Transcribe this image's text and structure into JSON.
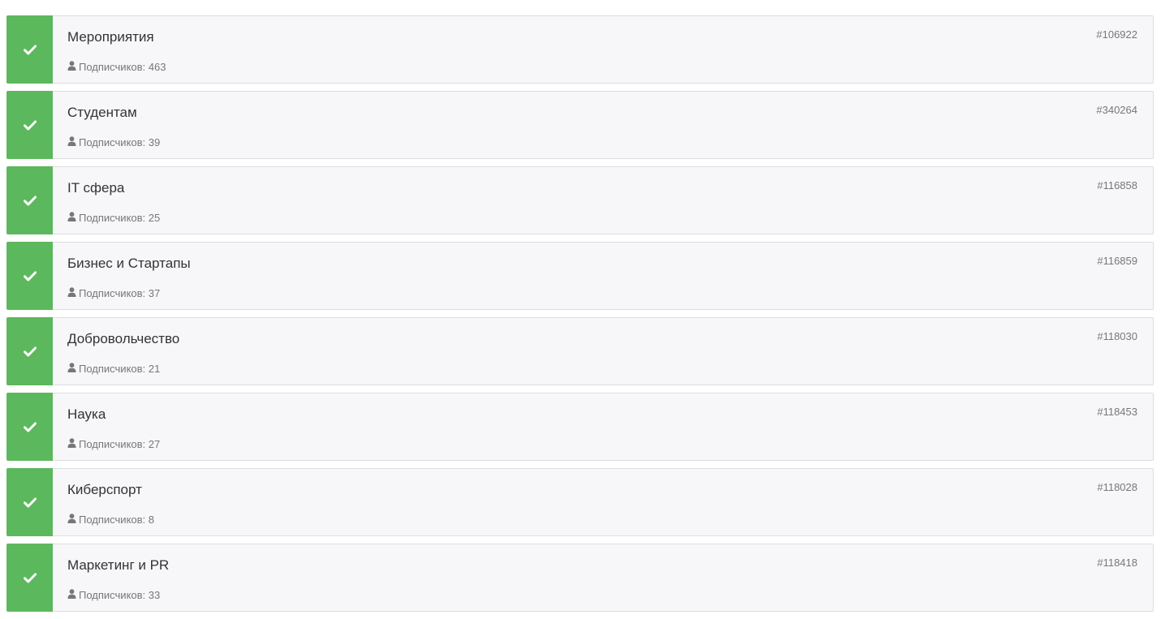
{
  "subscriber_prefix": "Подписчиков:",
  "colors": {
    "check_bg": "#5cb85c",
    "row_bg": "#f7f7f9",
    "row_border": "#dcdde2"
  },
  "icons": {
    "check": "check-icon",
    "user": "user-icon"
  },
  "items": [
    {
      "title": "Мероприятия",
      "subscribers": "Подписчиков: 463",
      "id": "#106922"
    },
    {
      "title": "Студентам",
      "subscribers": "Подписчиков: 39",
      "id": "#340264"
    },
    {
      "title": "IT сфера",
      "subscribers": "Подписчиков: 25",
      "id": "#116858"
    },
    {
      "title": "Бизнес и Стартапы",
      "subscribers": "Подписчиков: 37",
      "id": "#116859"
    },
    {
      "title": "Добровольчество",
      "subscribers": "Подписчиков: 21",
      "id": "#118030"
    },
    {
      "title": "Наука",
      "subscribers": "Подписчиков: 27",
      "id": "#118453"
    },
    {
      "title": "Киберспорт",
      "subscribers": "Подписчиков: 8",
      "id": "#118028"
    },
    {
      "title": "Маркетинг и PR",
      "subscribers": "Подписчиков: 33",
      "id": "#118418"
    }
  ]
}
